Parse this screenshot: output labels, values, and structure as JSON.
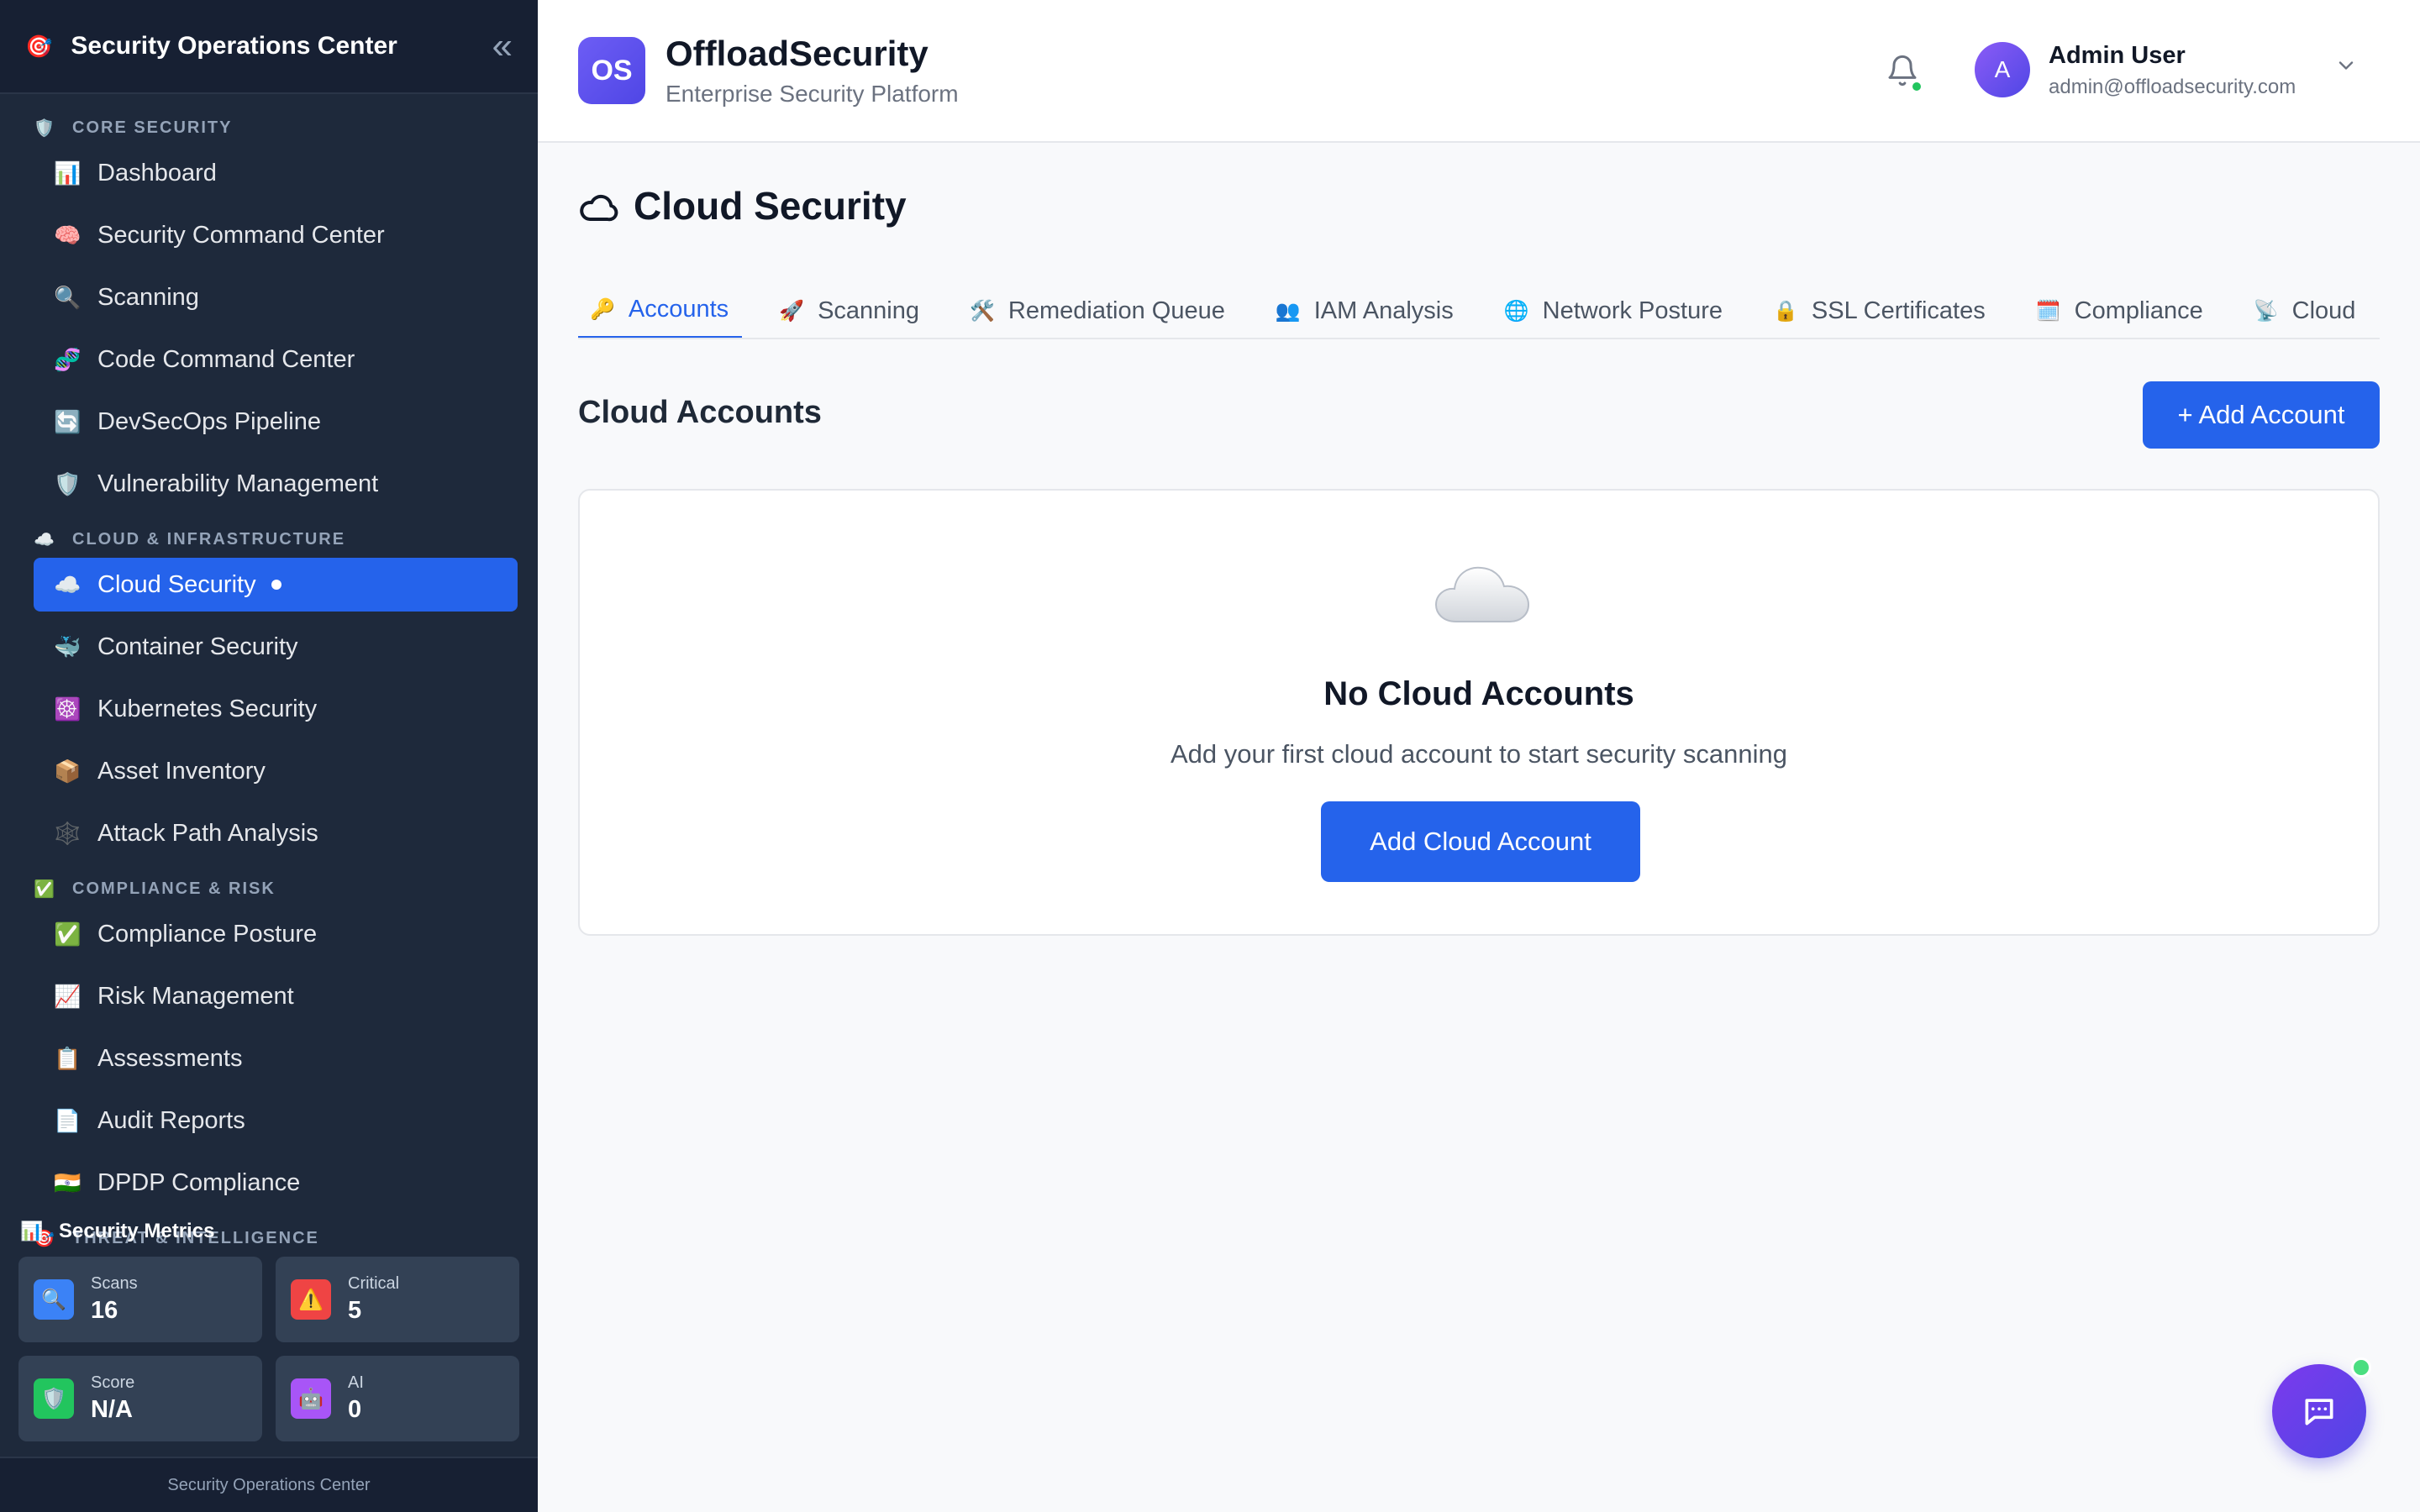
{
  "sidebar": {
    "title": "Security Operations Center",
    "logo_icon": "🎯",
    "collapse_icon": "«",
    "sections": [
      {
        "label": "CORE SECURITY",
        "icon": "🛡️",
        "items": [
          {
            "label": "Dashboard",
            "icon": "📊"
          },
          {
            "label": "Security Command Center",
            "icon": "🧠"
          },
          {
            "label": "Scanning",
            "icon": "🔍"
          },
          {
            "label": "Code Command Center",
            "icon": "🧬"
          },
          {
            "label": "DevSecOps Pipeline",
            "icon": "🔄"
          },
          {
            "label": "Vulnerability Management",
            "icon": "🛡️"
          }
        ]
      },
      {
        "label": "CLOUD & INFRASTRUCTURE",
        "icon": "☁️",
        "items": [
          {
            "label": "Cloud Security",
            "icon": "☁️",
            "active": true
          },
          {
            "label": "Container Security",
            "icon": "🐳"
          },
          {
            "label": "Kubernetes Security",
            "icon": "☸️"
          },
          {
            "label": "Asset Inventory",
            "icon": "📦"
          },
          {
            "label": "Attack Path Analysis",
            "icon": "🕸️"
          }
        ]
      },
      {
        "label": "COMPLIANCE & RISK",
        "icon": "✅",
        "items": [
          {
            "label": "Compliance Posture",
            "icon": "✅"
          },
          {
            "label": "Risk Management",
            "icon": "📈"
          },
          {
            "label": "Assessments",
            "icon": "📋"
          },
          {
            "label": "Audit Reports",
            "icon": "📄"
          },
          {
            "label": "DPDP Compliance",
            "icon": "🇮🇳"
          }
        ]
      },
      {
        "label": "THREAT & INTELLIGENCE",
        "icon": "🎯",
        "items": []
      }
    ],
    "metrics": {
      "title": "Security Metrics",
      "icon": "📊",
      "cards": [
        {
          "label": "Scans",
          "value": "16",
          "icon": "🔍",
          "color": "#3b82f6"
        },
        {
          "label": "Critical",
          "value": "5",
          "icon": "⚠️",
          "color": "#ef4444"
        },
        {
          "label": "Score",
          "value": "N/A",
          "icon": "🛡️",
          "color": "#22c55e"
        },
        {
          "label": "AI",
          "value": "0",
          "icon": "🤖",
          "color": "#a855f7"
        }
      ]
    },
    "footer": "Security Operations Center"
  },
  "header": {
    "logo_text": "OS",
    "brand_name": "OffloadSecurity",
    "brand_tagline": "Enterprise Security Platform",
    "user": {
      "initial": "A",
      "name": "Admin User",
      "email": "admin@offloadsecurity.com"
    },
    "notification_indicator_color": "#22c55e"
  },
  "main": {
    "page_title": "Cloud Security",
    "tabs": [
      {
        "label": "Accounts",
        "icon": "🔑",
        "active": true
      },
      {
        "label": "Scanning",
        "icon": "🚀"
      },
      {
        "label": "Remediation Queue",
        "icon": "🛠️"
      },
      {
        "label": "IAM Analysis",
        "icon": "👥"
      },
      {
        "label": "Network Posture",
        "icon": "🌐"
      },
      {
        "label": "SSL Certificates",
        "icon": "🔒"
      },
      {
        "label": "Compliance",
        "icon": "🗓️"
      },
      {
        "label": "Cloud",
        "icon": "📡"
      }
    ],
    "section_title": "Cloud Accounts",
    "add_account_label": "+ Add Account",
    "empty_state": {
      "icon": "cloud-icon",
      "title": "No Cloud Accounts",
      "subtitle": "Add your first cloud account to start security scanning",
      "button_label": "Add Cloud Account"
    }
  },
  "colors": {
    "accent": "#2563eb",
    "sidebar_bg": "#1e293b",
    "status_online": "#4ade80"
  }
}
